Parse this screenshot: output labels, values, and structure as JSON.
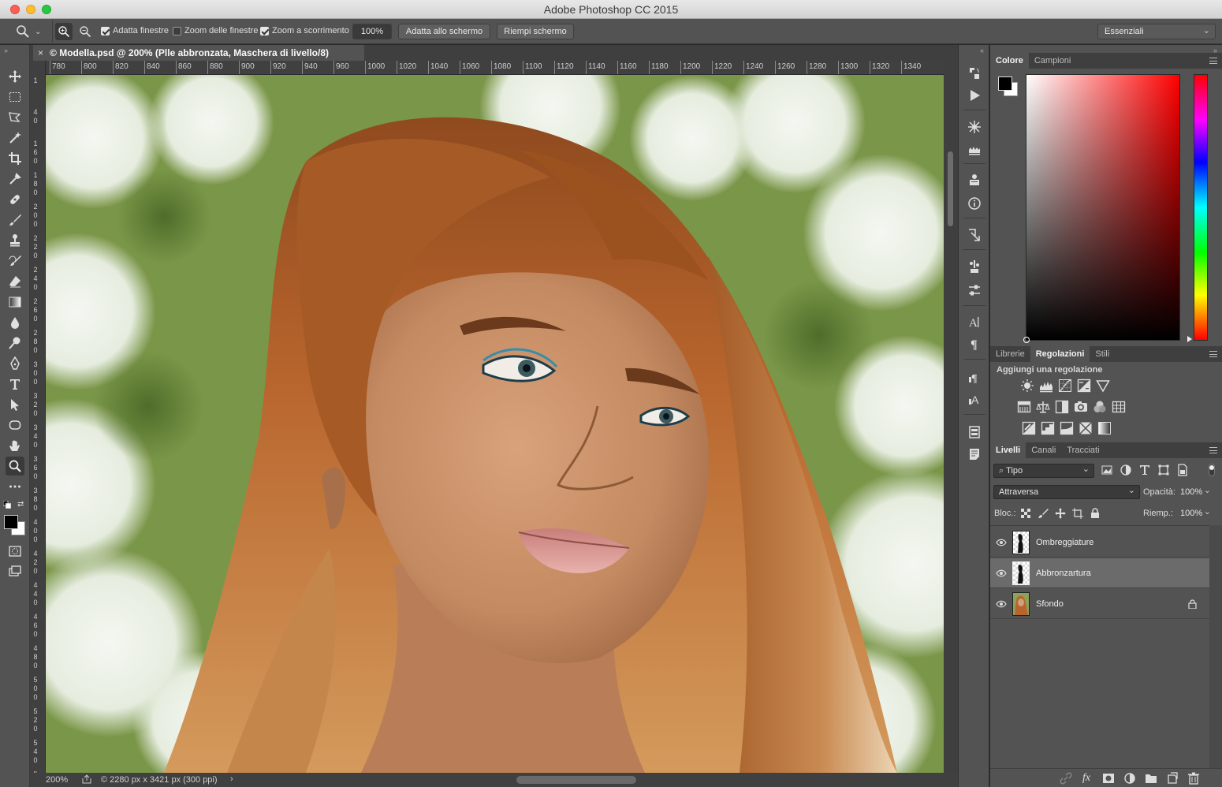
{
  "window": {
    "title": "Adobe Photoshop CC 2015"
  },
  "options_bar": {
    "fit_windows": {
      "label": "Adatta finestre",
      "checked": true
    },
    "zoom_all_windows": {
      "label": "Zoom delle finestre",
      "checked": false
    },
    "scrubby_zoom": {
      "label": "Zoom a scorrimento",
      "checked": true
    },
    "zoom_value": "100%",
    "fit_screen_label": "Adatta allo schermo",
    "fill_screen_label": "Riempi schermo",
    "workspace": "Essenziali"
  },
  "document": {
    "tab_title": "© Modella.psd @ 200% (Plle abbronzata, Maschera di livello/8)",
    "close_glyph": "×"
  },
  "ruler": {
    "h_ticks": [
      "780",
      "800",
      "820",
      "840",
      "860",
      "880",
      "900",
      "920",
      "940",
      "960",
      "1000",
      "1020",
      "1040",
      "1060",
      "1080",
      "1100",
      "1120",
      "1140",
      "1160",
      "1180",
      "1200",
      "1220",
      "1240",
      "1260",
      "1280",
      "1300",
      "1320",
      "1340"
    ],
    "v_ticks": [
      "1",
      "4\n0",
      "1\n6\n0",
      "1\n8\n0",
      "2\n0\n0",
      "2\n2\n0",
      "2\n4\n0",
      "2\n6\n0",
      "2\n8\n0",
      "3\n0\n0",
      "3\n2\n0",
      "3\n4\n0",
      "3\n6\n0",
      "3\n8\n0",
      "4\n0\n0",
      "4\n2\n0",
      "4\n4\n0",
      "4\n6\n0",
      "4\n8\n0",
      "5\n0\n0",
      "5\n2\n0",
      "5\n4\n0",
      "5\n6\n0"
    ]
  },
  "status": {
    "zoom": "200%",
    "doc_info": "© 2280 px x 3421 px (300 ppi)",
    "arrow": "›"
  },
  "color_panel": {
    "tabs": [
      "Colore",
      "Campioni"
    ],
    "active_tab": "Colore",
    "foreground": "#000000",
    "background": "#ffffff",
    "hue": "#ff0000"
  },
  "adjustments_panel": {
    "tabs": [
      "Librerie",
      "Regolazioni",
      "Stili"
    ],
    "active_tab": "Regolazioni",
    "heading": "Aggiungi una regolazione",
    "icons_row1": [
      "brightness-contrast-icon",
      "levels-icon",
      "curves-icon",
      "exposure-icon",
      "vibrance-icon"
    ],
    "icons_row2": [
      "hue-saturation-icon",
      "color-balance-icon",
      "black-white-icon",
      "photo-filter-icon",
      "channel-mixer-icon",
      "color-lookup-icon"
    ],
    "icons_row3": [
      "invert-icon",
      "posterize-icon",
      "threshold-icon",
      "selective-color-icon",
      "gradient-map-icon"
    ]
  },
  "layers_panel": {
    "tabs": [
      "Livelli",
      "Canali",
      "Tracciati"
    ],
    "active_tab": "Livelli",
    "filter_kind": "Tipo",
    "blend_mode": "Attraversa",
    "opacity_label": "Opacità:",
    "opacity_value": "100%",
    "lock_label": "Bloc.:",
    "fill_label": "Riemp.:",
    "fill_value": "100%",
    "layers": [
      {
        "name": "Ombreggiature",
        "selected": false,
        "locked": false
      },
      {
        "name": "Abbronzartura",
        "selected": true,
        "locked": false
      },
      {
        "name": "Sfondo",
        "selected": false,
        "locked": true
      }
    ],
    "footer_fx": "fx"
  },
  "colors": {
    "panel_bg": "#535353",
    "panel_dark": "#3f3f3f",
    "selected_row": "#6b6b6b",
    "hair": "#b8652d"
  }
}
